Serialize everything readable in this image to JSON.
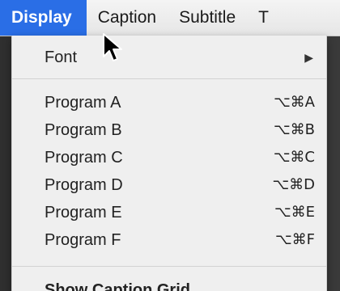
{
  "menubar": {
    "items": [
      {
        "label": "Display"
      },
      {
        "label": "Caption"
      },
      {
        "label": "Subtitle"
      },
      {
        "label": "T"
      }
    ]
  },
  "menu": {
    "font": {
      "label": "Font"
    },
    "programs": [
      {
        "label": "Program A",
        "shortcut": "⌥⌘A"
      },
      {
        "label": "Program B",
        "shortcut": "⌥⌘B"
      },
      {
        "label": "Program C",
        "shortcut": "⌥⌘C"
      },
      {
        "label": "Program D",
        "shortcut": "⌥⌘D"
      },
      {
        "label": "Program E",
        "shortcut": "⌥⌘E"
      },
      {
        "label": "Program F",
        "shortcut": "⌥⌘F"
      }
    ],
    "grid": {
      "label": "Show Caption Grid"
    }
  },
  "colors": {
    "highlight": "#2a6ee6",
    "menu_background": "#efefef"
  },
  "icons": {
    "cursor": "arrow-cursor-icon",
    "submenu": "submenu-arrow-icon"
  }
}
